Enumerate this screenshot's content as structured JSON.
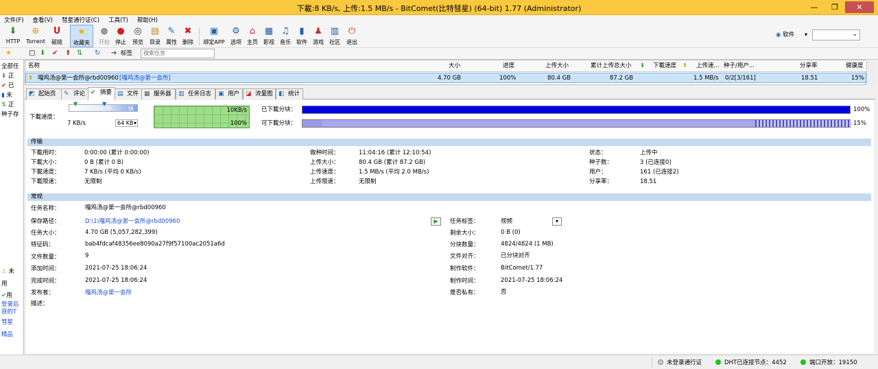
{
  "title": "下載:8 KB/s, 上传:1.5 MB/s - BitComet(比特彗星) (64-bit) 1.77 (Administrator)",
  "window_controls": [
    "—",
    "❐",
    "✕"
  ],
  "menu": [
    "文件(F)",
    "查看(V)",
    "彗星通行证(C)",
    "工具(T)",
    "帮助(H)"
  ],
  "toolbar": {
    "items": [
      {
        "label": "HTTP",
        "icon": "⬇"
      },
      {
        "label": "Torrent",
        "icon": "⊕"
      },
      {
        "label": "磁链",
        "icon": "U"
      },
      {
        "label": "收藏夹",
        "icon": "★"
      },
      {
        "label": "开始",
        "icon": "●"
      },
      {
        "label": "停止",
        "icon": "●"
      },
      {
        "label": "预览",
        "icon": "◎"
      },
      {
        "label": "目录",
        "icon": "▤"
      },
      {
        "label": "属性",
        "icon": "✎"
      },
      {
        "label": "删除",
        "icon": "✖"
      },
      {
        "label": "绑定APP",
        "icon": "▣"
      },
      {
        "label": "选项",
        "icon": "⚙"
      },
      {
        "label": "主页",
        "icon": "⌂"
      },
      {
        "label": "影视",
        "icon": "▦"
      },
      {
        "label": "音乐",
        "icon": "♫"
      },
      {
        "label": "软件",
        "icon": "▮"
      },
      {
        "label": "游戏",
        "icon": "♟"
      },
      {
        "label": "社区",
        "icon": "▥"
      },
      {
        "label": "退出",
        "icon": "⏻"
      }
    ],
    "software_label": "软件"
  },
  "toolbar2": {
    "tag_label": "标签",
    "search_placeholder": "搜索任务"
  },
  "sidebar": {
    "items": [
      "全部任",
      "正",
      "已",
      "未",
      "正",
      "种子存"
    ],
    "bottom": [
      "未",
      "用",
      "用",
      "登录后",
      "获的T",
      "彗星",
      "精品"
    ]
  },
  "task_list": {
    "columns": [
      "名称",
      "大小",
      "进度",
      "上传大小",
      "累计上传总大小",
      "下載速度",
      "上传速...",
      "种子/用户...",
      "分享率",
      "健康度"
    ],
    "rows": [
      {
        "name": "嘎鸡汤@第一会所@rbd00960",
        "tag": "[嘎鸡汤@第一会所]",
        "size": "4.70 GB",
        "progress": "100%",
        "uploaded": "80.4 GB",
        "total_uploaded": "87.2 GB",
        "down_speed": "",
        "up_speed": "1.5 MB/s",
        "seeds_peers": "0/2[3/161]",
        "share_ratio": "18.51",
        "health": "15%"
      }
    ]
  },
  "tabs": [
    "起始页",
    "评论",
    "摘要",
    "文件",
    "服务器",
    "任务日志",
    "用户",
    "流量图",
    "统计"
  ],
  "speed": {
    "label": "下載速度：",
    "levels": [
      "慢",
      "中",
      "快"
    ],
    "current": "7 KB/s",
    "limit": "64 KB",
    "graph_top": "10KB/s",
    "graph_bottom": "100%",
    "downloaded_label": "已下載分块：",
    "downloaded_pct": "100%",
    "downloaded_fraction": 1.0,
    "available_label": "可下載分块：",
    "available_pct": "15%",
    "available_fraction": 0.15
  },
  "transfer": {
    "header": "传输",
    "col1": [
      [
        "下載用时：",
        "0:00:00 (累计 0:00:00)"
      ],
      [
        "下載大小：",
        "0 B (累计 0 B)"
      ],
      [
        "下載速度：",
        "7 KB/s (平均 0 KB/s)"
      ],
      [
        "下載限速：",
        "无限制"
      ]
    ],
    "col2": [
      [
        "做种时间：",
        "11:04:16 (累计 12:10:54)"
      ],
      [
        "上传大小：",
        "80.4 GB (累计 87.2 GB)"
      ],
      [
        "上传速度：",
        "1.5 MB/s (平均 2.0 MB/s)"
      ],
      [
        "上传限速：",
        "无限制"
      ]
    ],
    "col3": [
      [
        "状态：",
        "上传中"
      ],
      [
        "种子数：",
        "3 (已连接0)"
      ],
      [
        "用户：",
        "161 (已连接2)"
      ],
      [
        "分享率：",
        "18.51"
      ]
    ]
  },
  "general": {
    "header": "常规",
    "left": [
      [
        "任务名称：",
        "嘎鸡汤@第一会所@rbd00960"
      ],
      [
        "保存路径：",
        "D:\\1\\嘎鸡汤@第一会所@rbd00960"
      ],
      [
        "任务大小：",
        "4.70 GB (5,057,282,399)"
      ],
      [
        "特征码：",
        "bab4fdcaf48356ee8090a27f9f57100ac2051a6d"
      ],
      [
        "文件数量：",
        "9"
      ],
      [
        "添加时间：",
        "2021-07-25 18:06:24"
      ],
      [
        "完成时间：",
        "2021-07-25 18:06:24"
      ],
      [
        "发布者：",
        "嘎鸡汤@第一会所"
      ],
      [
        "描述：",
        ""
      ]
    ],
    "right": [
      [
        "任务标签：",
        "视频"
      ],
      [
        "剩余大小：",
        "0 B (0)"
      ],
      [
        "分块数量：",
        "4824/4824 (1 MB)"
      ],
      [
        "文件对齐：",
        "已分块对齐"
      ],
      [
        "制作软件：",
        "BitComet/1.77"
      ],
      [
        "制作时间：",
        "2021-07-25 18:06:24"
      ],
      [
        "是否私有：",
        "否"
      ]
    ]
  },
  "status": {
    "passport": "未登录通行证",
    "dht": "DHT已连接节点：4452",
    "port": "端口开放：19150"
  },
  "colors": {
    "title_bar": "#fbc93f",
    "selected_row": "#cce4f7",
    "section_header": "#c5d9f1",
    "progress_blue": "#0000e0",
    "graph_green": "#9fdc8c",
    "link_blue": "#1b4fd6",
    "status_green": "#1ec31e"
  }
}
